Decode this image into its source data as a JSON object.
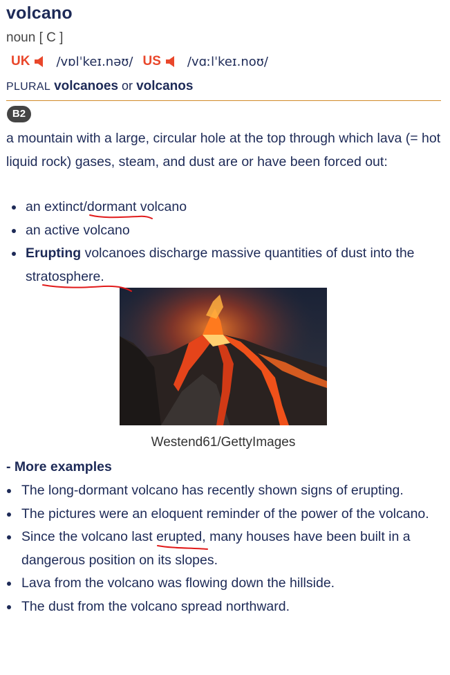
{
  "entry": {
    "headword": "volcano",
    "pos": "noun",
    "grammar": "[ C ]",
    "pronunciations": [
      {
        "region": "UK",
        "ipa": "/vɒlˈkeɪ.nəʊ/",
        "icon": "speaker-icon"
      },
      {
        "region": "US",
        "ipa": "/vɑːlˈkeɪ.noʊ/",
        "icon": "speaker-icon"
      }
    ],
    "plural": {
      "label": "PLURAL",
      "form1": "volcanoes",
      "or": "or",
      "form2": "volcanos"
    },
    "level": "B2",
    "definition": "a mountain with a large, circular hole at the top through which lava (= hot liquid rock) gases, steam, and dust are or have been forced out:",
    "examples": [
      {
        "pre": "an extinct/",
        "mark": "dormant",
        "post": " volcano"
      },
      {
        "pre": "an active volcano"
      },
      {
        "bold": "Erupting",
        "pre": " volcanoes discharge massive quantities of dust into the ",
        "mark": "stratosphere",
        "post": "."
      }
    ],
    "image_credit": "Westend61/GettyImages",
    "more_label": "- More examples",
    "more_examples": [
      {
        "pre": "The long-dormant volcano has recently shown signs of erupting."
      },
      {
        "pre": "The pictures were an ",
        "mark": "eloquent",
        "post": " reminder of the power of the volcano."
      },
      {
        "pre": "Since the volcano last erupted, many houses have been built in a dangerous position on its slopes."
      },
      {
        "pre": "Lava from the volcano was flowing down the hillside."
      },
      {
        "pre": "The dust from the volcano spread northward."
      }
    ]
  },
  "colors": {
    "text": "#1d2a57",
    "region": "#e9472b",
    "rule": "#d08a27",
    "badge": "#444444",
    "underline": "#e11a1a"
  }
}
